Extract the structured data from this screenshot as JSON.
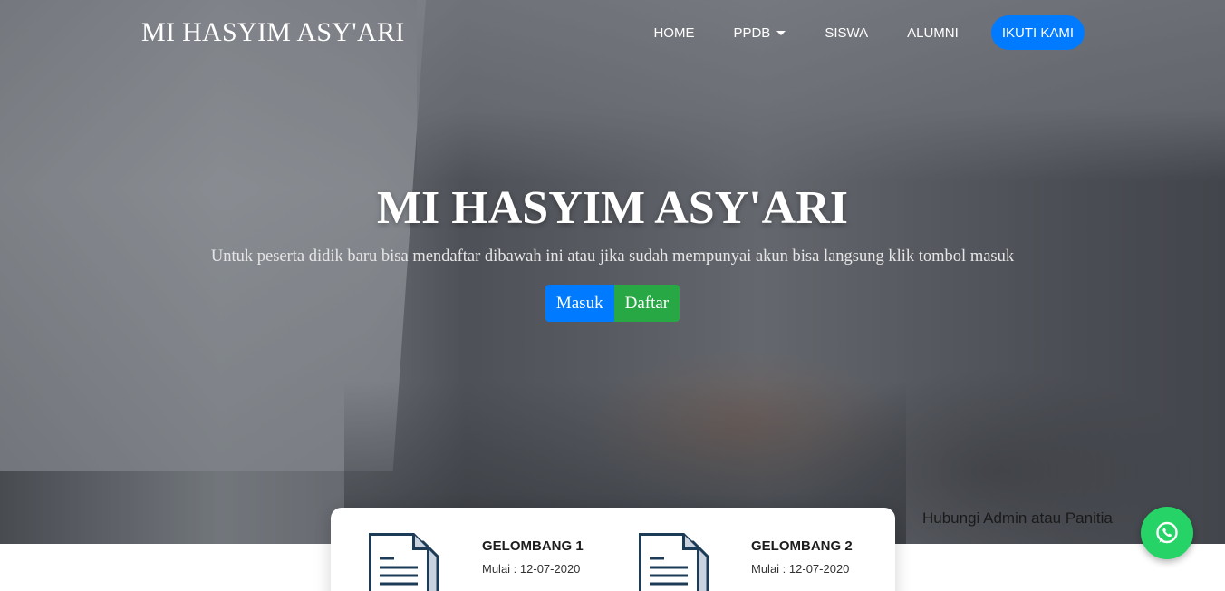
{
  "navbar": {
    "brand": "MI HASYIM ASY'ARI",
    "links": [
      {
        "label": "HOME"
      },
      {
        "label": "PPDB"
      },
      {
        "label": "SISWA"
      },
      {
        "label": "ALUMNI"
      }
    ],
    "cta_label": "IKUTI KAMI"
  },
  "hero": {
    "title": "MI HASYIM ASY'ARI",
    "subtitle": "Untuk peserta didik baru bisa mendaftar dibawah ini atau jika sudah mempunyai akun bisa langsung klik tombol masuk",
    "login_label": "Masuk",
    "register_label": "Daftar"
  },
  "whatsapp": {
    "label": "Hubungi Admin atau Panitia",
    "icon": "whatsapp-icon"
  },
  "waves": [
    {
      "title": "GELOMBANG 1",
      "date": "Mulai : 12-07-2020",
      "icon": "document-icon"
    },
    {
      "title": "GELOMBANG 2",
      "date": "Mulai : 12-07-2020",
      "icon": "document-icon"
    }
  ],
  "colors": {
    "primary": "#007bff",
    "success": "#28a745",
    "whatsapp": "#25d366",
    "icon_stroke": "#1c3b57"
  }
}
